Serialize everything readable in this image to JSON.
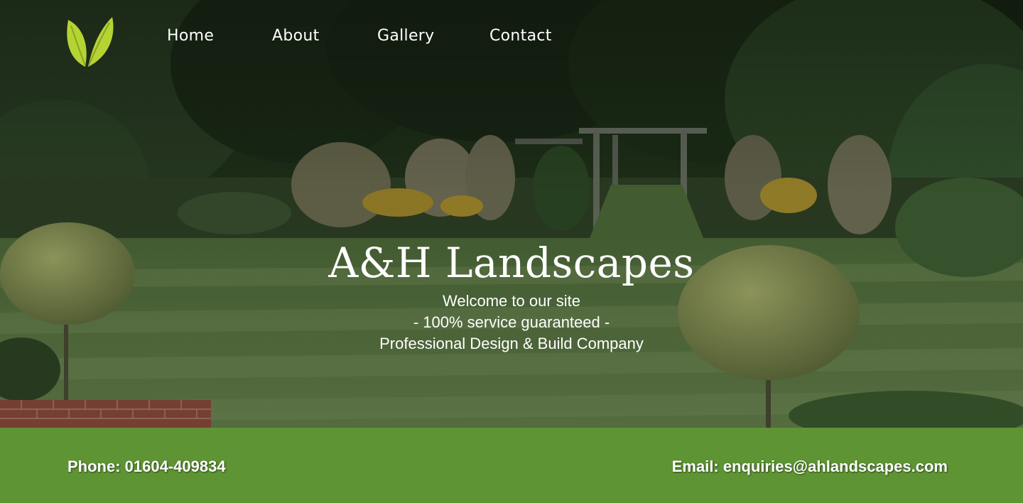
{
  "nav": {
    "items": [
      {
        "label": "Home"
      },
      {
        "label": "About"
      },
      {
        "label": "Gallery"
      },
      {
        "label": "Contact"
      }
    ]
  },
  "hero": {
    "title": "A&H Landscapes",
    "lines": [
      "Welcome to our site",
      "- 100% service guaranteed -",
      "Professional Design & Build Company"
    ]
  },
  "contact": {
    "phone": "Phone: 01604-409834",
    "email": "Email: enquiries@ahlandscapes.com"
  },
  "colors": {
    "contact_bar": "#5e9434",
    "logo_leaf": "#b6d334",
    "lawn": "#5f7d44",
    "text": "#ffffff"
  },
  "icons": {
    "logo": "leaf-logo-icon"
  }
}
